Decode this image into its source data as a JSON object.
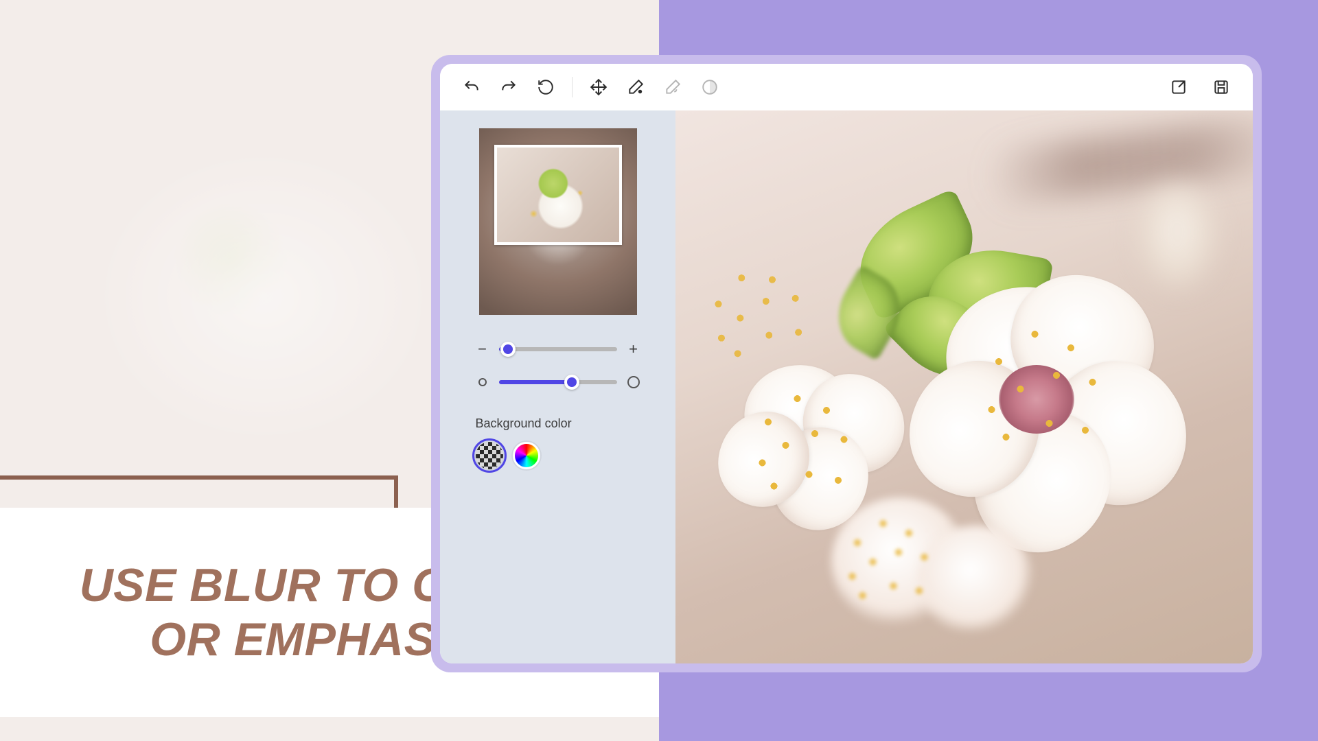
{
  "marketing": {
    "headline_line1": "USE BLUR TO COVER",
    "headline_line2": "OR EMPHASIZE"
  },
  "toolbar": {
    "undo": "undo",
    "redo": "redo",
    "reset": "reset",
    "move": "move",
    "erase": "erase",
    "erase_bg": "background-erase",
    "adjust": "adjust",
    "export": "export",
    "save": "save"
  },
  "panel": {
    "zoom_slider": {
      "min": 0,
      "max": 100,
      "value": 8
    },
    "blur_slider": {
      "min": 0,
      "max": 100,
      "value": 62
    },
    "bg_color_label": "Background color",
    "swatches": {
      "transparent_selected": true,
      "options": [
        "transparent",
        "custom-color"
      ]
    }
  },
  "colors": {
    "accent": "#5046e5",
    "frame_purple": "#c8bcec",
    "headline": "#a0715d"
  }
}
